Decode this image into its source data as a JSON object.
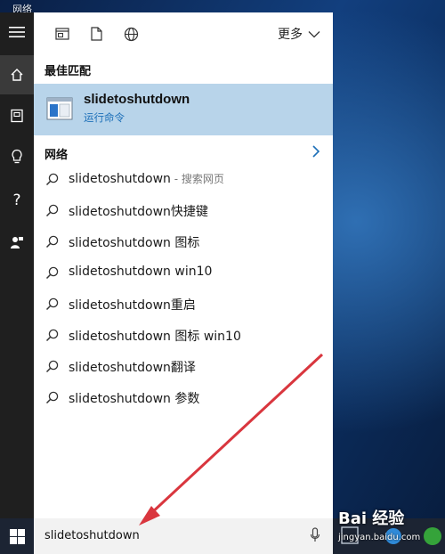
{
  "desktop": {
    "label": "网络"
  },
  "rail": {
    "items": [
      {
        "name": "menu"
      },
      {
        "name": "home"
      },
      {
        "name": "notebook"
      },
      {
        "name": "tips"
      },
      {
        "name": "help"
      },
      {
        "name": "feedback"
      }
    ]
  },
  "panel": {
    "top": {
      "more_label": "更多"
    },
    "best_match": {
      "section_title": "最佳匹配",
      "name": "slidetoshutdown",
      "type": "运行命令"
    },
    "network": {
      "section_title": "网络"
    },
    "suggestions": [
      {
        "text": "slidetoshutdown",
        "sub": " - 搜索网页"
      },
      {
        "text": "slidetoshutdown快捷键",
        "sub": ""
      },
      {
        "text": "slidetoshutdown 图标",
        "sub": ""
      },
      {
        "text": "slidetoshutdown win10",
        "sub": ""
      },
      {
        "text": "slidetoshutdown重启",
        "sub": ""
      },
      {
        "text": "slidetoshutdown 图标 win10",
        "sub": ""
      },
      {
        "text": "slidetoshutdown翻译",
        "sub": ""
      },
      {
        "text": "slidetoshutdown 参数",
        "sub": ""
      }
    ]
  },
  "taskbar": {
    "search_value": "slidetoshutdown",
    "watermark": "Bai 经验",
    "watermark_sub": "jingyan.baidu.com"
  },
  "colors": {
    "accent": "#1c6fb8",
    "selection": "#b8d4ea",
    "arrow": "#d9363e"
  }
}
